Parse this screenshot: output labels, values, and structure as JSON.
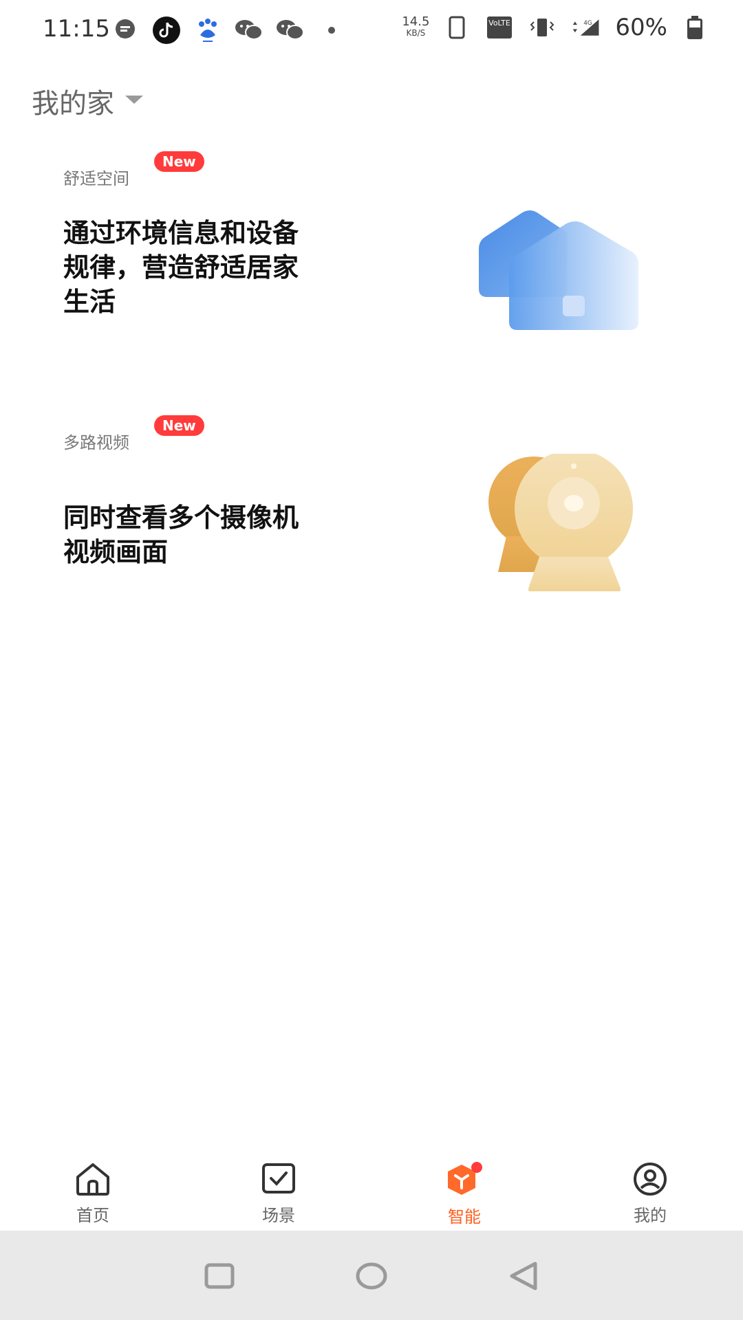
{
  "status_bar": {
    "time": "11:15",
    "net_speed_value": "14.5",
    "net_speed_unit": "KB/S",
    "battery_percent": "60%",
    "network_label": "4G",
    "volte_label": "VoLTE"
  },
  "header": {
    "home_name": "我的家"
  },
  "cards": [
    {
      "tag": "舒适空间",
      "badge": "New",
      "title_lines": [
        "通过环境信息和设备",
        "规律，营造舒适居家",
        "生活"
      ]
    },
    {
      "tag": "多路视频",
      "badge": "New",
      "title_lines": [
        "同时查看多个摄像机",
        "视频画面"
      ]
    }
  ],
  "bottom_nav": {
    "items": [
      {
        "label": "首页",
        "icon": "home-icon"
      },
      {
        "label": "场景",
        "icon": "checkbox-icon"
      },
      {
        "label": "智能",
        "icon": "smart-icon",
        "active": true
      },
      {
        "label": "我的",
        "icon": "profile-icon"
      }
    ]
  },
  "colors": {
    "accent": "#ff5f1f",
    "badge": "#ff3b3b",
    "blue_illustration": "#5b9be8",
    "gold_illustration": "#e9b45a"
  }
}
